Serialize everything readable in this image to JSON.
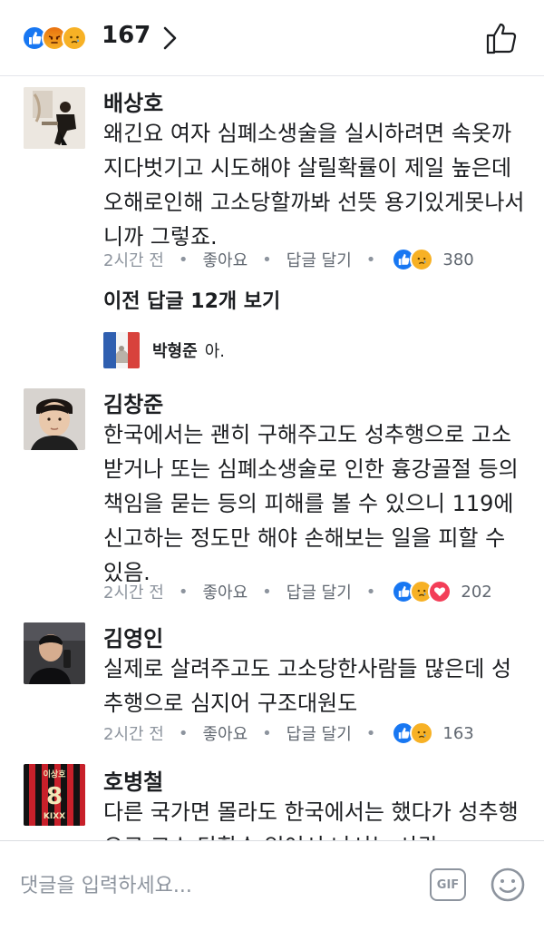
{
  "header": {
    "reaction_count": "167",
    "reaction_icons": [
      "like-icon",
      "angry-icon",
      "sad-icon"
    ]
  },
  "comments": [
    {
      "author": "배상호",
      "text": "왜긴요 여자 심폐소생술을 실시하려면 속옷까지다벗기고 시도해야 살릴확률이 제일 높은데 오해로인해 고소당할까봐 선뜻 용기있게못나서니까 그렇죠.",
      "time": "2시간 전",
      "like_label": "좋아요",
      "reply_label": "답글 달기",
      "reaction_count": "380"
    },
    {
      "author": "김창준",
      "text": "한국에서는 괜히 구해주고도 성추행으로 고소받거나 또는 심폐소생술로 인한 흉강골절 등의 책임을 묻는 등의 피해를 볼 수 있으니 119에 신고하는 정도만 해야 손해보는 일을 피할 수 있음.",
      "time": "2시간 전",
      "like_label": "좋아요",
      "reply_label": "답글 달기",
      "reaction_count": "202"
    },
    {
      "author": "김영인",
      "text": "실제로 살려주고도 고소당한사람들 많은데 성추행으로 심지어 구조대원도",
      "time": "2시간 전",
      "like_label": "좋아요",
      "reply_label": "답글 달기",
      "reaction_count": "163"
    },
    {
      "author": "호병철",
      "text": "다른 국가면 몰라도 한국에서는 했다가 성추행으로 고소 당할수 있어서 나서는 사람"
    }
  ],
  "more_replies": "이전 답글 12개 보기",
  "reply": {
    "author": "박형준",
    "text": "아."
  },
  "avatar4_jersey": {
    "name": "이상호",
    "number": "8",
    "sponsor": "KIXX"
  },
  "composer": {
    "placeholder": "댓글을 입력하세요...",
    "gif_label": "GIF"
  },
  "colors": {
    "like": "#1877f2",
    "sad": "#f7b125",
    "love": "#f33e58",
    "muted": "#8d949e"
  }
}
